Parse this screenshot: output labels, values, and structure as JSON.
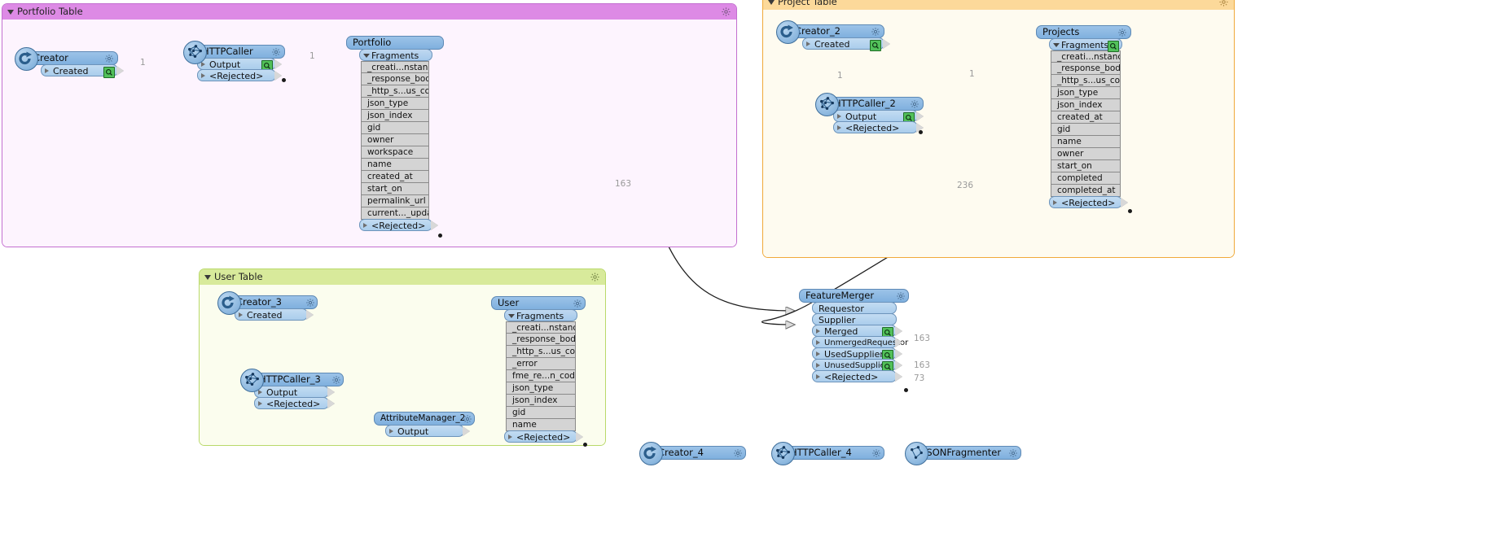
{
  "app": {
    "canvas_background": "#ffffff"
  },
  "bookmarks": [
    {
      "id": "portfolio",
      "title": "Portfolio Table",
      "header_color": "#dd8ae5",
      "body_color": "#fdf4fe",
      "border_color": "#c36fd0"
    },
    {
      "id": "project",
      "title": "Project Table",
      "header_color": "#fcd99a",
      "body_color": "#fefbf0",
      "border_color": "#f0a93a"
    },
    {
      "id": "user",
      "title": "User Table",
      "header_color": "#d8ea9b",
      "body_color": "#fbfdee",
      "border_color": "#b9d96a"
    }
  ],
  "nodes": {
    "creator": {
      "title": "Creator",
      "ports": [
        "Created"
      ]
    },
    "httpcaller": {
      "title": "HTTPCaller",
      "ports": [
        "Output",
        "<Rejected>"
      ]
    },
    "portfolio": {
      "title": "Portfolio",
      "fragments": "Fragments",
      "attributes": [
        "_creati...nstance",
        "_response_body",
        "_http_s...us_code",
        "json_type",
        "json_index",
        "gid",
        "owner",
        "workspace",
        "name",
        "created_at",
        "start_on",
        "permalink_url",
        "current..._update"
      ],
      "rejected": "<Rejected>"
    },
    "creator_2": {
      "title": "Creator_2",
      "ports": [
        "Created"
      ]
    },
    "httpcaller_2": {
      "title": "HTTPCaller_2",
      "ports": [
        "Output",
        "<Rejected>"
      ]
    },
    "projects": {
      "title": "Projects",
      "fragments": "Fragments",
      "attributes": [
        "_creati...nstance",
        "_response_body",
        "_http_s...us_code",
        "json_type",
        "json_index",
        "created_at",
        "gid",
        "name",
        "owner",
        "start_on",
        "completed",
        "completed_at"
      ],
      "rejected": "<Rejected>"
    },
    "creator_3": {
      "title": "Creator_3",
      "ports": [
        "Created"
      ]
    },
    "httpcaller_3": {
      "title": "HTTPCaller_3",
      "ports": [
        "Output",
        "<Rejected>"
      ]
    },
    "attributemanager_2": {
      "title": "AttributeManager_2",
      "ports": [
        "Output"
      ]
    },
    "user": {
      "title": "User",
      "fragments": "Fragments",
      "attributes": [
        "_creati...nstance",
        "_response_body",
        "_http_s...us_code",
        "_error",
        "fme_re...n_code",
        "json_type",
        "json_index",
        "gid",
        "name"
      ],
      "rejected": "<Rejected>"
    },
    "featuremerger": {
      "title": "FeatureMerger",
      "inputs": [
        "Requestor",
        "Supplier"
      ],
      "outputs": [
        "Merged",
        "UnmergedRequestor",
        "UsedSupplier",
        "UnusedSupplier",
        "<Rejected>"
      ]
    },
    "creator_4": {
      "title": "Creator_4"
    },
    "httpcaller_4": {
      "title": "HTTPCaller_4"
    },
    "jsonfragmenter": {
      "title": "JSONFragmenter"
    }
  },
  "link_counts": {
    "creator_to_http": "1",
    "http_to_portfolio": "1",
    "creator2_to_http2": "1",
    "http2_to_projects": "1",
    "portfolio_to_merger": "163",
    "projects_to_merger": "236"
  },
  "feature_counts": {
    "merged": "163",
    "used_supplier": "163",
    "unused_supplier": "73"
  },
  "icons": {
    "gear": "gear-icon",
    "magnifier": "magnifier-icon",
    "collapse_triangle": "collapse-triangle-icon",
    "port_triangle": "port-triangle-icon"
  }
}
